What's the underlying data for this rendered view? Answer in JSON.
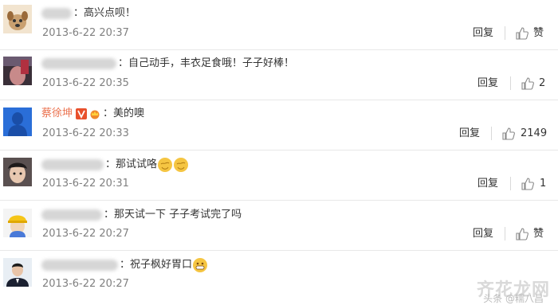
{
  "comments": [
    {
      "text": "：高兴点呗！",
      "time": "2013-6-22 20:37",
      "reply": "回复",
      "likes": "赞",
      "like_is_label": true
    },
    {
      "text": "：自己动手，丰衣足食哦！子子好棒！",
      "time": "2013-6-22 20:35",
      "reply": "回复",
      "likes": "2"
    },
    {
      "username": "蔡徐坤",
      "text": "：美的噢",
      "time": "2013-6-22 20:33",
      "reply": "回复",
      "likes": "2149"
    },
    {
      "text": "：那试试咯",
      "time": "2013-6-22 20:31",
      "reply": "回复",
      "likes": "1"
    },
    {
      "text": "：那天试一下 子子考试完了吗",
      "time": "2013-6-22 20:27",
      "reply": "回复",
      "likes": "赞",
      "like_is_label": true
    },
    {
      "text": "：祝子枫好胃口",
      "time": "2013-6-22 20:27",
      "reply": "回复",
      "likes": ""
    }
  ],
  "watermark": {
    "main": "齐花龙网",
    "sub": "头条 @糯八昌"
  },
  "colors": {
    "username": "#eb7350",
    "timestamp": "#808080",
    "divider": "#e8e8e8"
  },
  "icons": [
    "thumbs-up-icon",
    "verified-v-badge-icon",
    "crown-badge-icon",
    "emoji-icon"
  ]
}
